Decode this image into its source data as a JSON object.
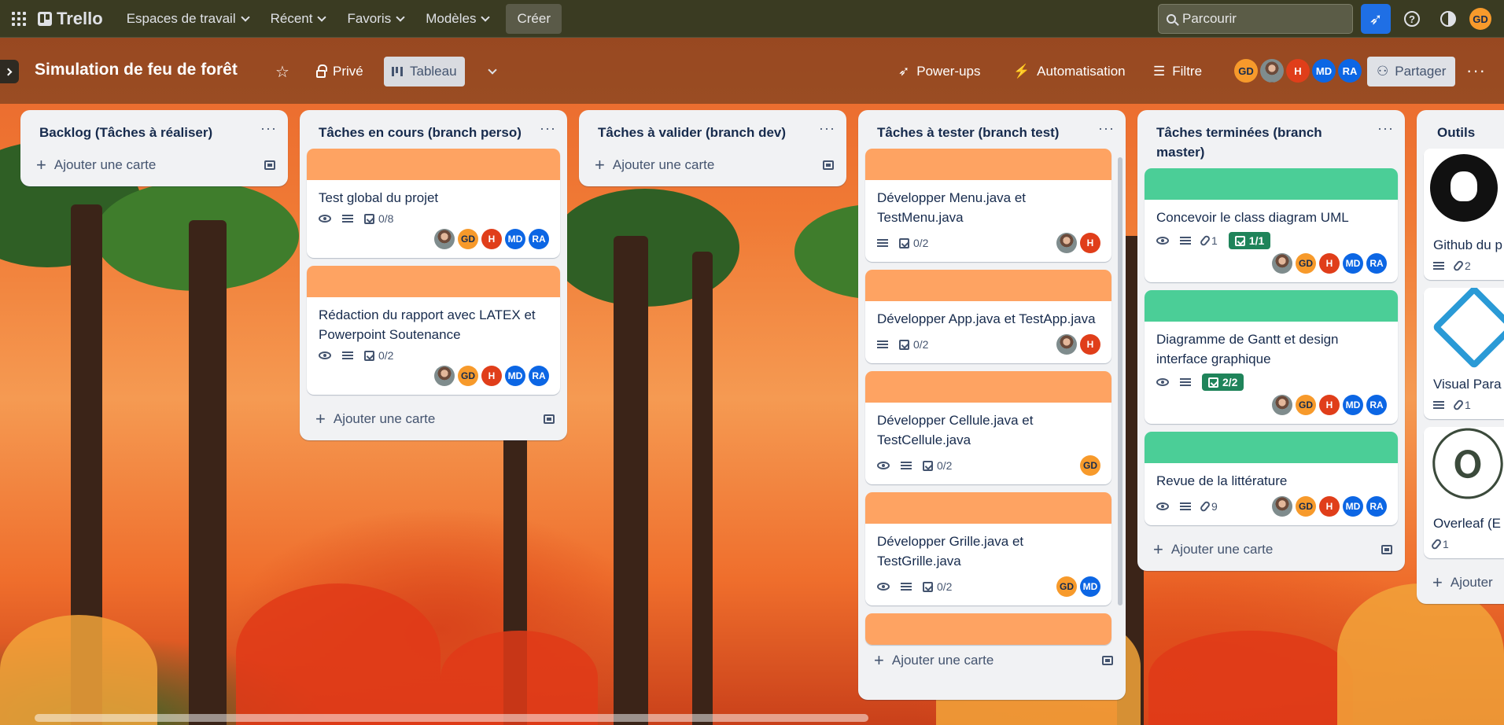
{
  "topnav": {
    "brand": "Trello",
    "menus": [
      "Espaces de travail",
      "Récent",
      "Favoris",
      "Modèles"
    ],
    "create_label": "Créer",
    "search_placeholder": "Parcourir",
    "user_initials": "GD"
  },
  "board": {
    "title": "Simulation de feu de forêt",
    "visibility": "Privé",
    "view": "Tableau",
    "powerups": "Power-ups",
    "automation": "Automatisation",
    "filter": "Filtre",
    "share": "Partager",
    "members": [
      "GD",
      "",
      "H",
      "MD",
      "RA"
    ]
  },
  "lists": [
    {
      "title": "Backlog (Tâches à réaliser)",
      "add_label": "Ajouter une carte",
      "cards": []
    },
    {
      "title": "Tâches en cours (branch perso)",
      "add_label": "Ajouter une carte",
      "cards": [
        {
          "title": "Test global du projet",
          "checklist": "0/8",
          "members": [
            "",
            "GD",
            "H",
            "MD",
            "RA"
          ]
        },
        {
          "title": "Rédaction du rapport avec LATEX et Powerpoint Soutenance",
          "checklist": "0/2",
          "members": [
            "",
            "GD",
            "H",
            "MD",
            "RA"
          ]
        }
      ]
    },
    {
      "title": "Tâches à valider (branch dev)",
      "add_label": "Ajouter une carte",
      "cards": []
    },
    {
      "title": "Tâches à tester (branch test)",
      "add_label": "Ajouter une carte",
      "cards": [
        {
          "title": "Développer Menu.java et TestMenu.java",
          "checklist": "0/2",
          "members": [
            "",
            "H"
          ]
        },
        {
          "title": "Développer App.java et TestApp.java",
          "checklist": "0/2",
          "members": [
            "",
            "H"
          ]
        },
        {
          "title": "Développer Cellule.java et TestCellule.java",
          "checklist": "0/2",
          "members": [
            "GD"
          ]
        },
        {
          "title": "Développer Grille.java et TestGrille.java",
          "checklist": "0/2",
          "members": [
            "GD",
            "MD"
          ]
        }
      ]
    },
    {
      "title": "Tâches terminées (branch master)",
      "add_label": "Ajouter une carte",
      "cards": [
        {
          "title": "Concevoir le class diagram UML",
          "attachments": "1",
          "checklist": "1/1",
          "members": [
            "",
            "GD",
            "H",
            "MD",
            "RA"
          ]
        },
        {
          "title": "Diagramme de Gantt et design interface graphique",
          "checklist": "2/2",
          "members": [
            "",
            "GD",
            "H",
            "MD",
            "RA"
          ]
        },
        {
          "title": "Revue de la littérature",
          "attachments": "9",
          "members": [
            "",
            "GD",
            "H",
            "MD",
            "RA"
          ]
        }
      ]
    },
    {
      "title": "Outils",
      "add_label": "Ajouter",
      "cards": [
        {
          "title": "Github du p",
          "attachments": "2"
        },
        {
          "title": "Visual Para",
          "attachments": "1"
        },
        {
          "title": "Overleaf (E",
          "attachments": "1"
        }
      ]
    }
  ]
}
